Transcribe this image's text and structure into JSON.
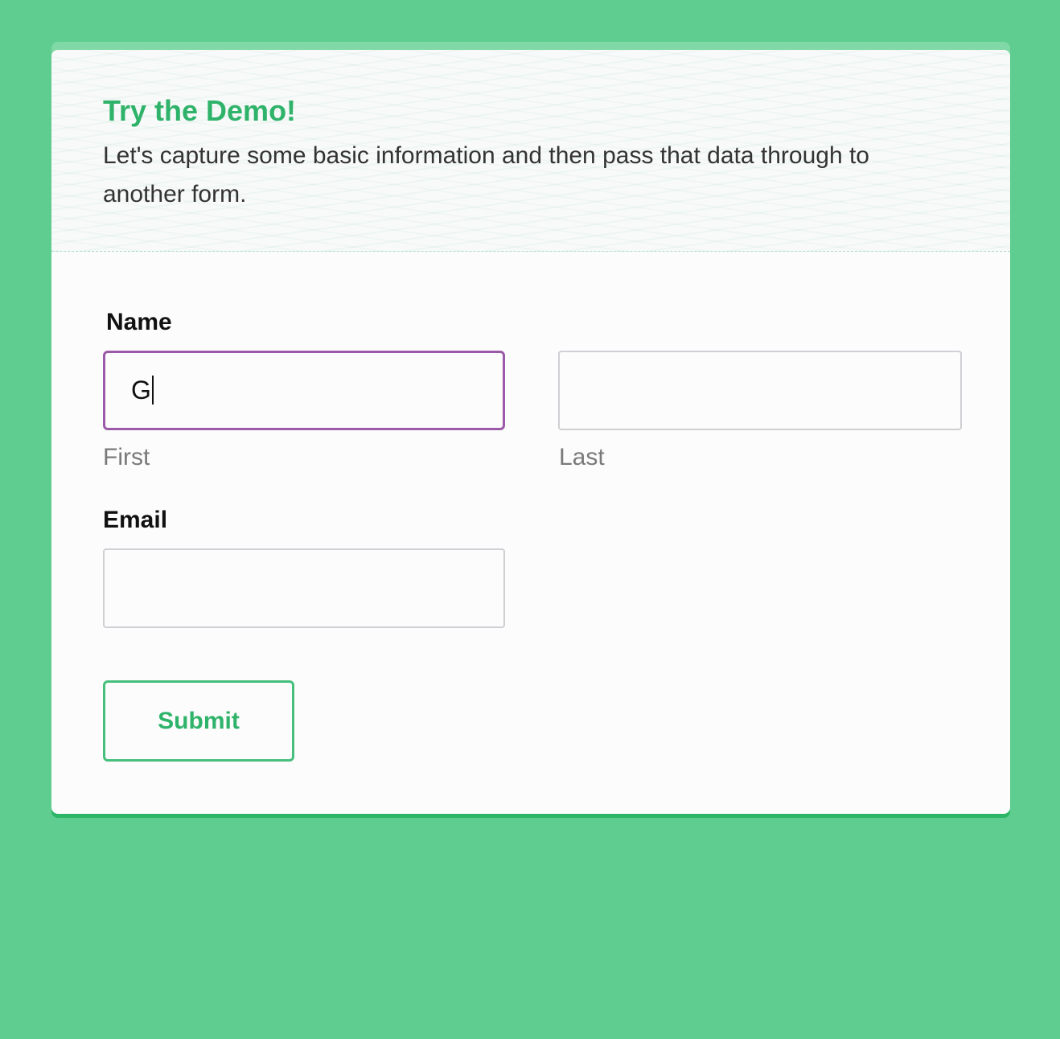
{
  "form": {
    "title": "Try the Demo!",
    "description": "Let's capture some basic information and then pass that data through to another form.",
    "name": {
      "label": "Name",
      "first": {
        "value": "G",
        "sublabel": "First"
      },
      "last": {
        "value": "",
        "sublabel": "Last"
      }
    },
    "email": {
      "label": "Email",
      "value": ""
    },
    "submit_label": "Submit"
  },
  "colors": {
    "background": "#5fcd8f",
    "accent": "#2fb36a",
    "focus_border": "#9b5aa8",
    "card": "#fcfcfc"
  }
}
